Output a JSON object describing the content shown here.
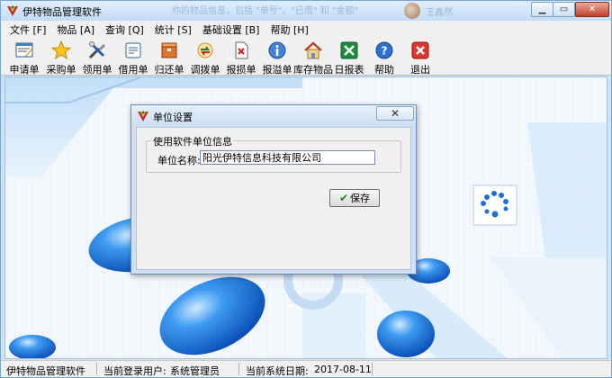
{
  "window": {
    "title": "伊特物品管理软件",
    "bg_title_text": "你的物品信息，包括 \"单号\"、\"已借\" 和 \"金额\"",
    "bg_user_name": "王鑫然"
  },
  "menu": [
    "文件 [F]",
    "物品 [A]",
    "查询 [Q]",
    "统计 [S]",
    "基础设置 [B]",
    "帮助 [H]"
  ],
  "toolbar": [
    {
      "label": "申请单",
      "icon": "application-form-icon"
    },
    {
      "label": "采购单",
      "icon": "star-icon"
    },
    {
      "label": "领用单",
      "icon": "tools-icon"
    },
    {
      "label": "借用单",
      "icon": "borrow-card-icon"
    },
    {
      "label": "归还单",
      "icon": "return-box-icon"
    },
    {
      "label": "调拨单",
      "icon": "transfer-arrows-icon"
    },
    {
      "label": "报损单",
      "icon": "damage-report-icon"
    },
    {
      "label": "报溢单",
      "icon": "info-icon"
    },
    {
      "label": "库存物品",
      "icon": "house-icon"
    },
    {
      "label": "日报表",
      "icon": "excel-icon"
    },
    {
      "label": "帮助",
      "icon": "help-icon"
    },
    {
      "label": "退出",
      "icon": "exit-icon"
    }
  ],
  "dialog": {
    "title": "单位设置",
    "group_label": "使用软件单位信息",
    "field_label": "单位名称:",
    "field_value": "阳光伊特信息科技有限公司",
    "save_label": "保存"
  },
  "statusbar": {
    "app_name": "伊特物品管理软件",
    "user_label": "当前登录用户:",
    "user_value": "系统管理员",
    "date_label": "当前系统日期:",
    "date_value": "2017-08-11"
  },
  "colors": {
    "accent": "#1e6fd9",
    "titlebar": "#cfe3f7",
    "close_button": "#c2402a"
  }
}
